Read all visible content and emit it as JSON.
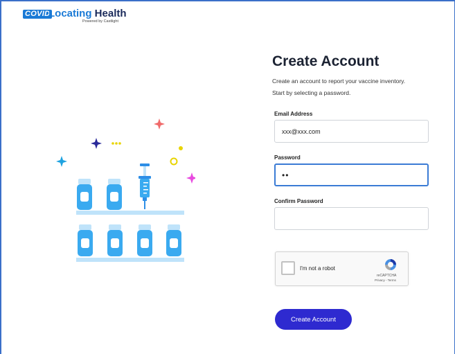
{
  "logo": {
    "badge": "COVID",
    "name_part1": "Locating",
    "name_part2": "Health",
    "powered_by": "Powered by Castlight",
    "brand_color": "#1a7ad6"
  },
  "form": {
    "title": "Create Account",
    "subtitle_line1": "Create an account to report your vaccine inventory.",
    "subtitle_line2": "Start by selecting a password.",
    "email_label": "Email Address",
    "email_value": "xxx@xxx.com",
    "password_label": "Password",
    "password_value": "••",
    "confirm_label": "Confirm Password",
    "confirm_value": "",
    "submit_label": "Create Account",
    "button_color": "#2e2ad0"
  },
  "captcha": {
    "label": "I'm not a robot",
    "brand": "reCAPTCHA",
    "links": "Privacy - Terms",
    "checked": false
  },
  "illustration": {
    "icon": "vaccine-vials-illustration",
    "vial_color": "#3aaaf0",
    "shelf_color": "#bfe3fa"
  }
}
